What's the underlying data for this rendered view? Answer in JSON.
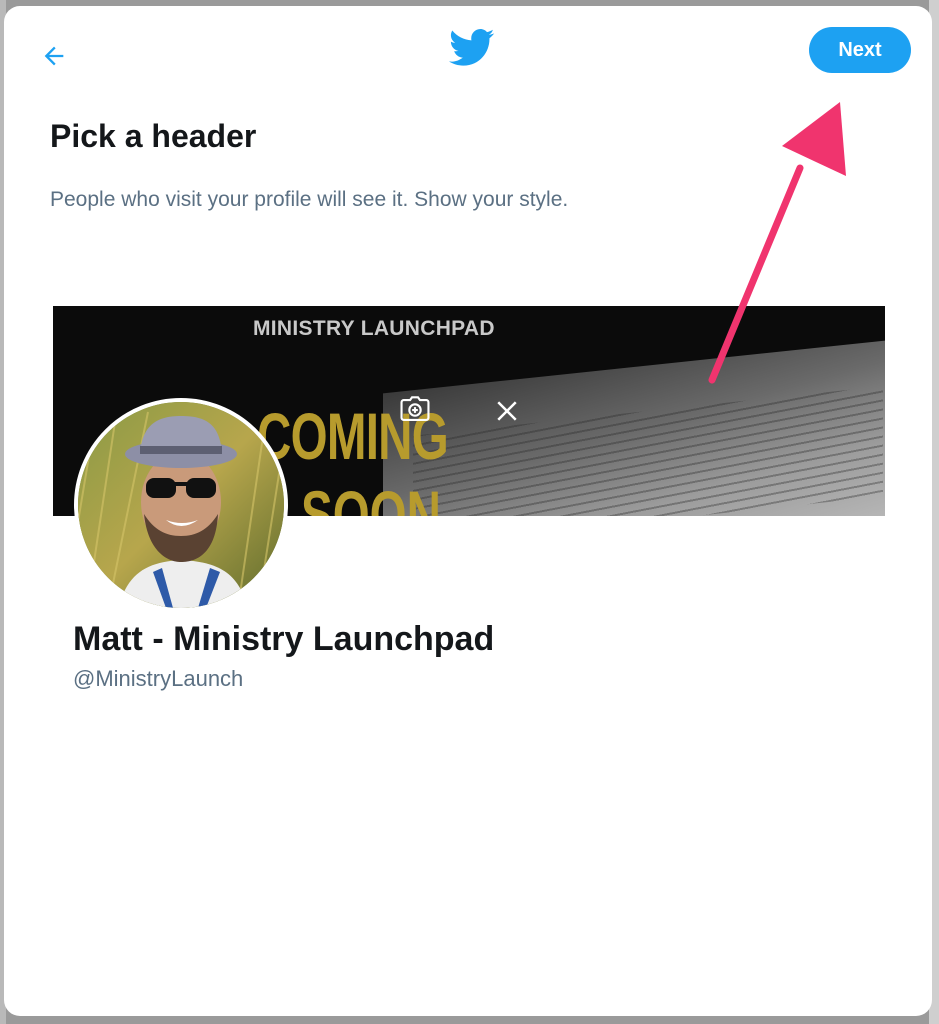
{
  "dialog": {
    "title": "Pick a header",
    "subtitle": "People who visit your profile will see it. Show your style.",
    "next_label": "Next"
  },
  "icons": {
    "back": "back-arrow-icon",
    "logo": "twitter-bird-icon",
    "add_photo": "camera-plus-icon",
    "remove": "close-icon"
  },
  "header_image": {
    "brand_text": "MINISTRY LAUNCHPAD",
    "line1": "COMING",
    "line2": "SOON"
  },
  "profile": {
    "display_name": "Matt - Ministry Launchpad",
    "handle": "@MinistryLaunch"
  },
  "colors": {
    "accent": "#1da1f2",
    "annotation_arrow": "#f0346e",
    "heading": "#14171a",
    "secondary_text": "#5b7083",
    "header_text_gold": "#b79b2d"
  }
}
